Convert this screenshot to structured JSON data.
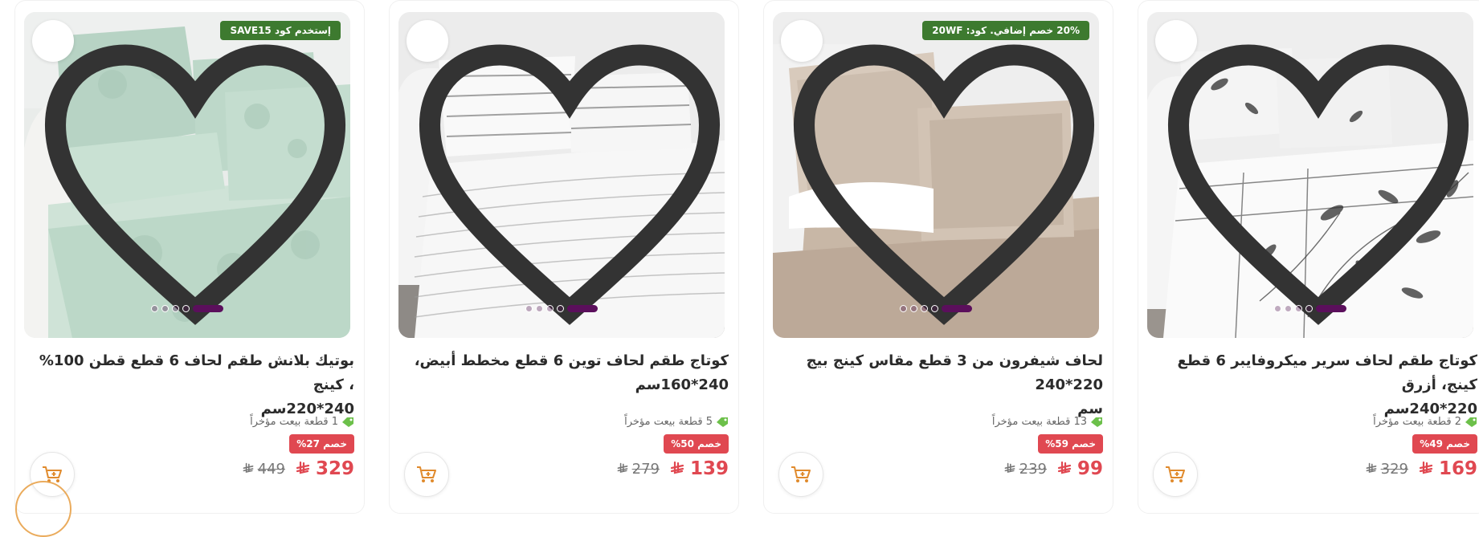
{
  "currency_icon": "saudi-riyal-icon",
  "colors": {
    "promo_green": "#3d7a2f",
    "discount_red": "#e04851",
    "carousel_purple": "#5b0f5c"
  },
  "products": [
    {
      "promo": "إستخدم كود SAVE15",
      "title_line1": "بوتيك بلانش طقم لحاف 6 قطع قطن 100% ، كينج",
      "title_line2": "240*220سم",
      "sold": "1 قطعة بيعت مؤخراً",
      "discount": "خصم 27%",
      "price": "329",
      "old_price": "449",
      "image": "mint-damask-bedding"
    },
    {
      "promo": "",
      "title_line1": "كوتاج طقم لحاف توين 6 قطع مخطط أبيض،",
      "title_line2": "240*160سم",
      "sold": "5 قطعة بيعت مؤخراً",
      "discount": "خصم 50%",
      "price": "139",
      "old_price": "279",
      "image": "white-striped-bedding"
    },
    {
      "promo": "20% خصم إضافي. كود: 20WF",
      "title_line1": "لحاف شيفرون من 3 قطع مقاس كينج بيج 220*240",
      "title_line2": "سم",
      "sold": "13 قطعة بيعت مؤخراً",
      "discount": "خصم 59%",
      "price": "99",
      "old_price": "239",
      "image": "beige-chevron-bedding"
    },
    {
      "promo": "",
      "title_line1": "كوتاج طقم لحاف سرير ميكروفايبر 6 قطع كينج، أزرق",
      "title_line2": "220*240سم",
      "sold": "2 قطعة بيعت مؤخراً",
      "discount": "خصم 49%",
      "price": "169",
      "old_price": "329",
      "image": "black-white-floral-bedding"
    }
  ]
}
